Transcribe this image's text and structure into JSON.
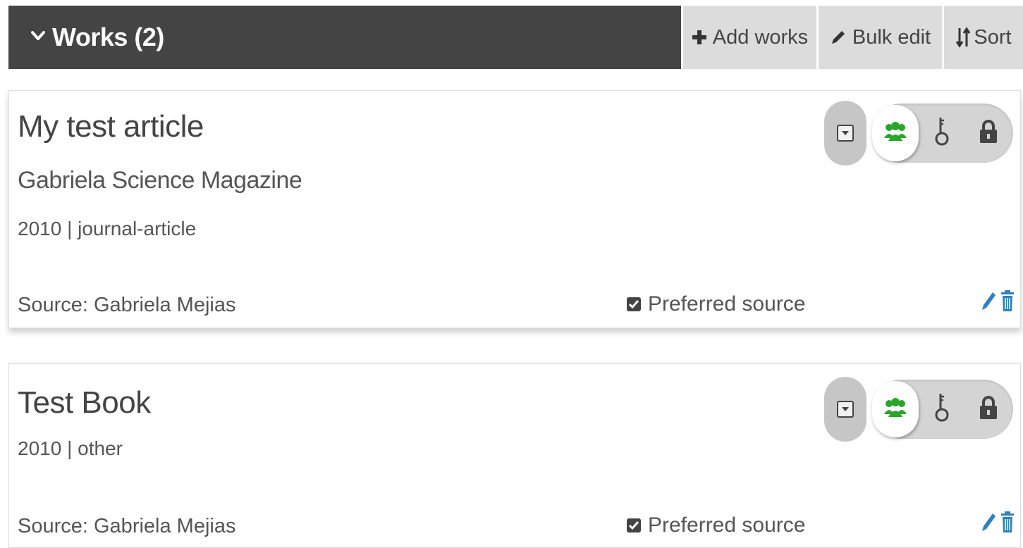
{
  "header": {
    "title": "Works (2)",
    "add_label": "Add works",
    "bulk_label": "Bulk edit",
    "sort_label": "Sort"
  },
  "works": [
    {
      "title": "My test article",
      "journal": "Gabriela Science Magazine",
      "meta": "2010 | journal-article",
      "source": "Source: Gabriela Mejias",
      "preferred": "Preferred source",
      "visibility": "public"
    },
    {
      "title": "Test Book",
      "meta": "2010 | other",
      "source": "Source: Gabriela Mejias",
      "preferred": "Preferred source",
      "visibility": "public"
    }
  ],
  "colors": {
    "header_bg": "#444444",
    "button_bg": "#dcdcdc",
    "public_green": "#2aa52a",
    "action_blue": "#2f7fc1"
  },
  "icons": [
    "chevron-down-icon",
    "plus-icon",
    "pencil-icon",
    "sort-icon",
    "dropdown-icon",
    "everyone-icon",
    "trusted-party-icon",
    "lock-icon",
    "checkbox-icon",
    "edit-icon",
    "trash-icon"
  ]
}
